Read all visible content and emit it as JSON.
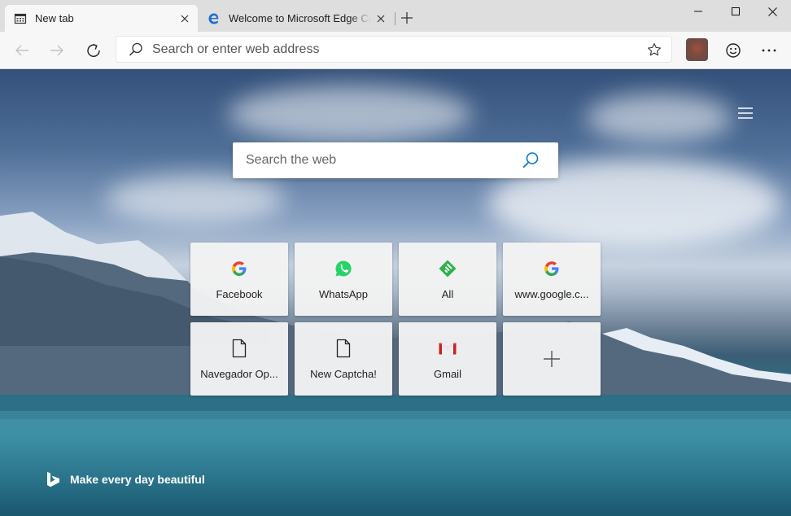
{
  "tabs": [
    {
      "title": "New tab",
      "active": true,
      "icon": "new-tab-page-icon"
    },
    {
      "title": "Welcome to Microsoft Edge Canary",
      "active": false,
      "icon": "edge-logo-icon"
    }
  ],
  "toolbar": {
    "address_placeholder": "Search or enter web address"
  },
  "page": {
    "search_placeholder": "Search the web",
    "tagline": "Make every day beautiful"
  },
  "tiles": [
    {
      "label": "Facebook",
      "icon": "google-g-icon"
    },
    {
      "label": "WhatsApp",
      "icon": "whatsapp-icon"
    },
    {
      "label": "All",
      "icon": "feedly-icon"
    },
    {
      "label": "www.google.c...",
      "icon": "google-g-icon"
    },
    {
      "label": "Navegador Op...",
      "icon": "page-icon"
    },
    {
      "label": "New Captcha!",
      "icon": "page-icon"
    },
    {
      "label": "Gmail",
      "icon": "gmail-icon"
    },
    {
      "label": "",
      "icon": "plus-icon"
    }
  ],
  "colors": {
    "accent": "#0078d4",
    "tab_active": "#f7f7f7",
    "titlebar": "#dedede"
  }
}
